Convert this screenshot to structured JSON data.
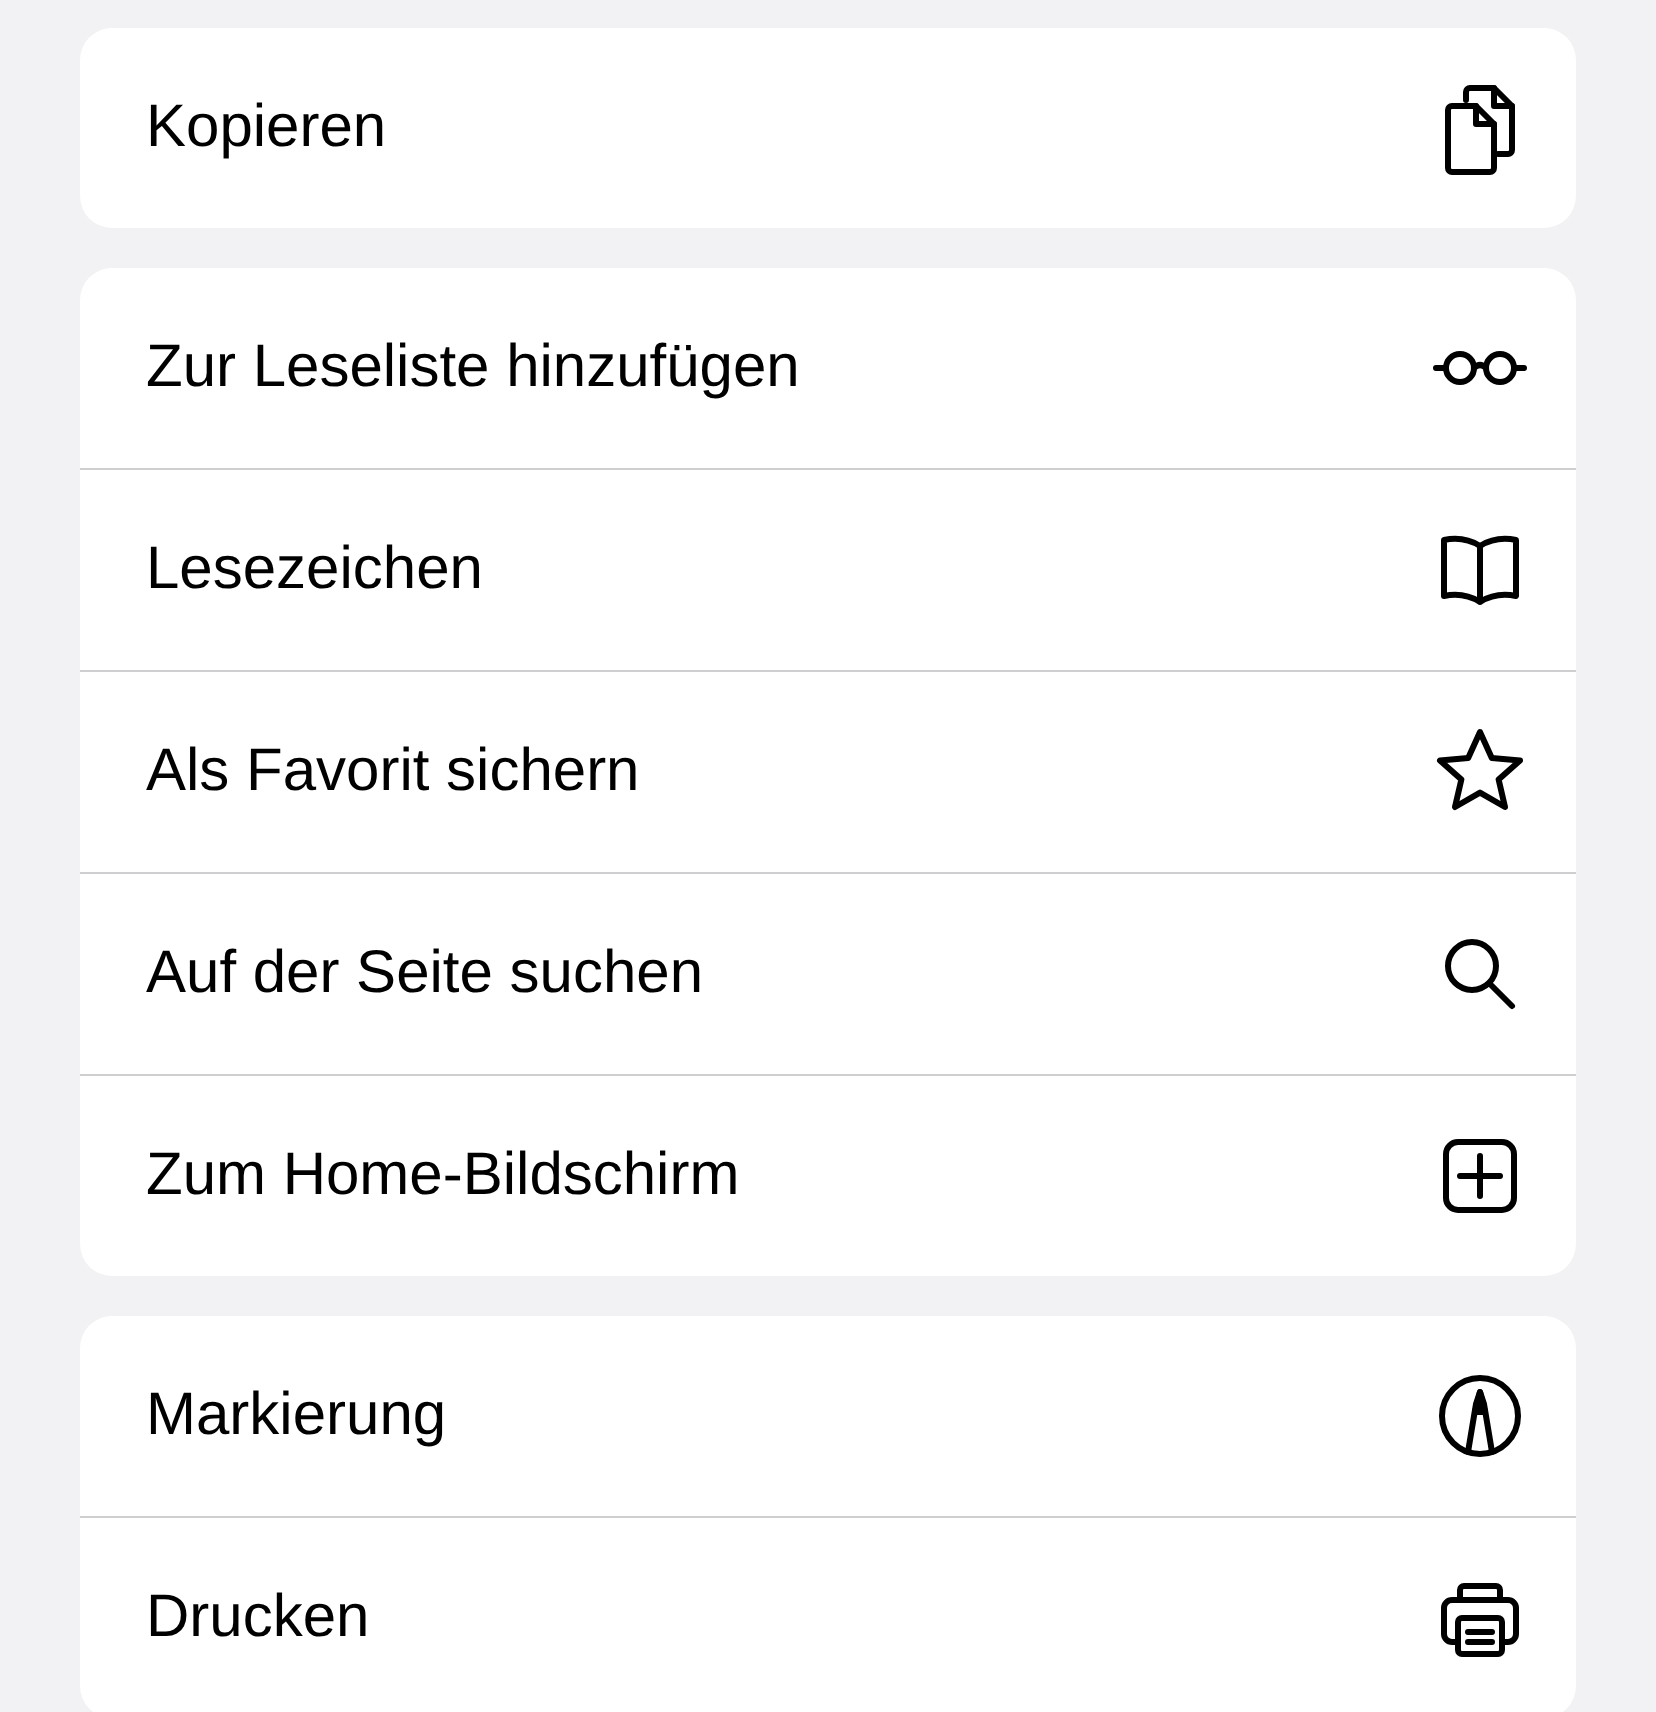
{
  "groups": [
    {
      "items": [
        {
          "label": "Kopieren"
        }
      ]
    },
    {
      "items": [
        {
          "label": "Zur Leseliste hinzufügen"
        },
        {
          "label": "Lesezeichen"
        },
        {
          "label": "Als Favorit sichern"
        },
        {
          "label": "Auf der Seite suchen"
        },
        {
          "label": "Zum Home-Bildschirm"
        }
      ]
    },
    {
      "items": [
        {
          "label": "Markierung"
        },
        {
          "label": "Drucken"
        }
      ]
    }
  ]
}
